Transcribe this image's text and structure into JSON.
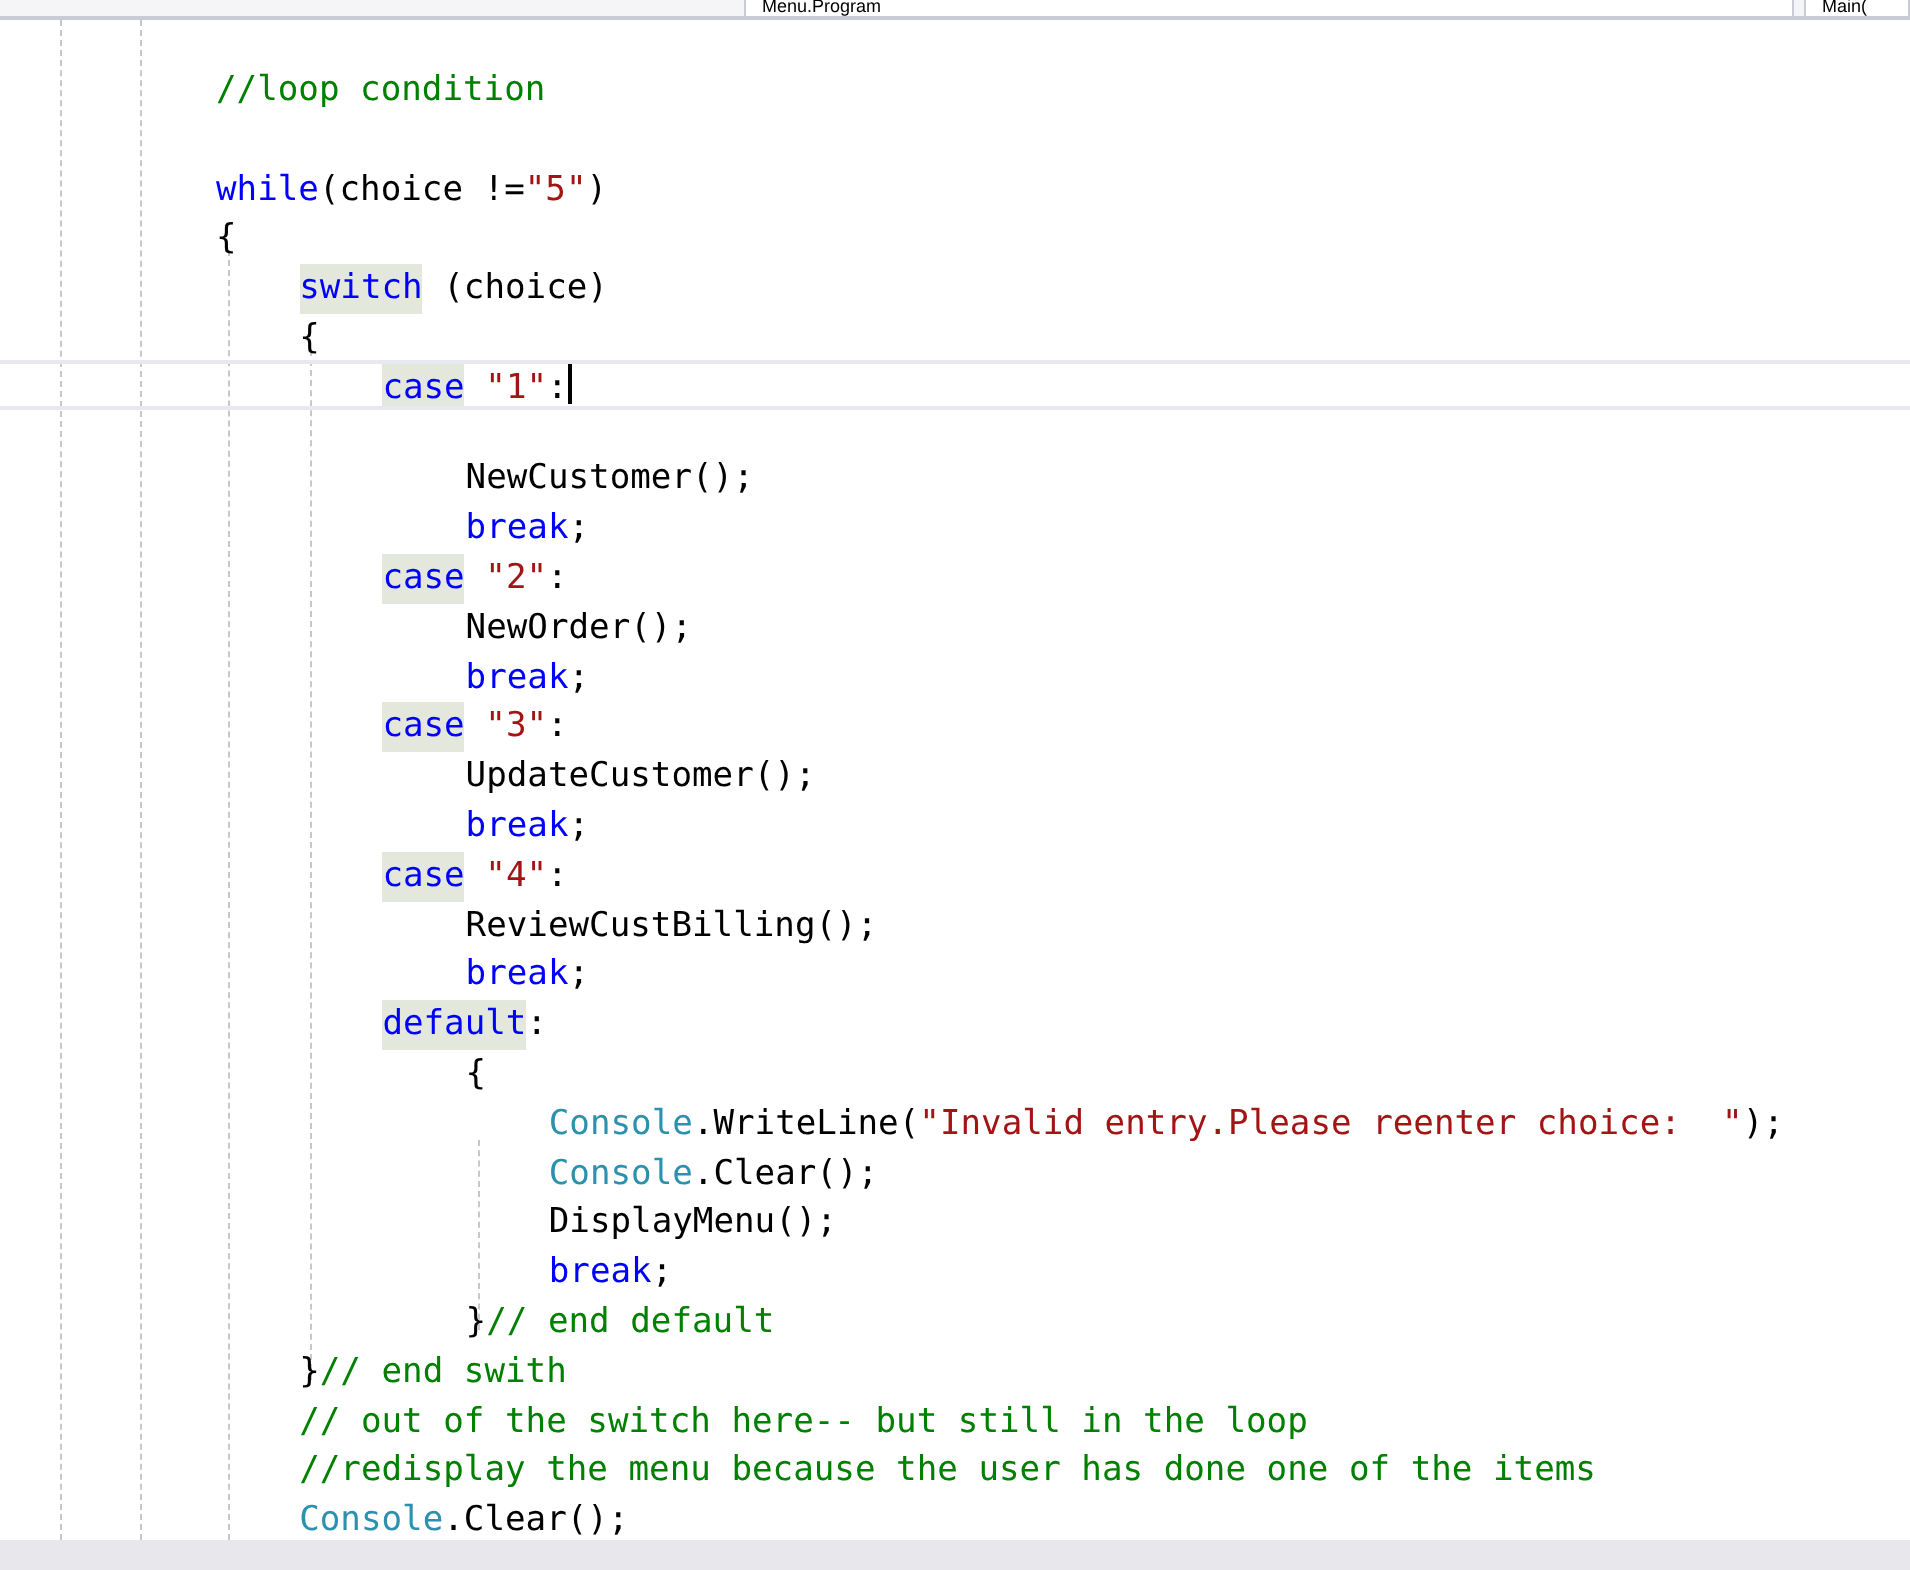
{
  "navigation_bar": {
    "dropdowns": [
      {
        "label": "Menu.Program"
      },
      {
        "label": "Main("
      }
    ]
  },
  "editor": {
    "lines": [
      {
        "kind": "code",
        "tokens": [
          {
            "kind": "comment",
            "text": "//loop condition"
          }
        ]
      },
      {
        "kind": "blank"
      },
      {
        "kind": "code",
        "tokens": [
          {
            "kind": "keyword",
            "text": "while"
          },
          {
            "kind": "plain",
            "text": "(choice !="
          },
          {
            "kind": "string",
            "text": "\"5\""
          },
          {
            "kind": "plain",
            "text": ")"
          }
        ]
      },
      {
        "kind": "code",
        "tokens": [
          {
            "kind": "plain",
            "text": "{"
          }
        ],
        "children": [
          {
            "kind": "code",
            "tokens": [
              {
                "kind": "keyword",
                "text": "switch",
                "highlighted": true
              },
              {
                "kind": "plain",
                "text": " (choice)"
              }
            ]
          },
          {
            "kind": "code",
            "tokens": [
              {
                "kind": "plain",
                "text": "{"
              }
            ],
            "children": [
              {
                "kind": "code",
                "current": true,
                "tokens": [
                  {
                    "kind": "keyword",
                    "text": "case",
                    "highlighted": true
                  },
                  {
                    "kind": "string",
                    "text": " \"1\""
                  },
                  {
                    "kind": "plain",
                    "text": ":"
                  }
                ],
                "children": [
                  {
                    "kind": "blank"
                  },
                  {
                    "kind": "code",
                    "tokens": [
                      {
                        "kind": "plain",
                        "text": "NewCustomer();"
                      }
                    ]
                  },
                  {
                    "kind": "code",
                    "tokens": [
                      {
                        "kind": "keyword",
                        "text": "break"
                      },
                      {
                        "kind": "plain",
                        "text": ";"
                      }
                    ]
                  }
                ]
              },
              {
                "kind": "code",
                "tokens": [
                  {
                    "kind": "keyword",
                    "text": "case",
                    "highlighted": true
                  },
                  {
                    "kind": "string",
                    "text": " \"2\""
                  },
                  {
                    "kind": "plain",
                    "text": ":"
                  }
                ],
                "children": [
                  {
                    "kind": "code",
                    "tokens": [
                      {
                        "kind": "plain",
                        "text": "NewOrder();"
                      }
                    ]
                  },
                  {
                    "kind": "code",
                    "tokens": [
                      {
                        "kind": "keyword",
                        "text": "break"
                      },
                      {
                        "kind": "plain",
                        "text": ";"
                      }
                    ]
                  }
                ]
              },
              {
                "kind": "code",
                "tokens": [
                  {
                    "kind": "keyword",
                    "text": "case",
                    "highlighted": true
                  },
                  {
                    "kind": "string",
                    "text": " \"3\""
                  },
                  {
                    "kind": "plain",
                    "text": ":"
                  }
                ],
                "children": [
                  {
                    "kind": "code",
                    "tokens": [
                      {
                        "kind": "plain",
                        "text": "UpdateCustomer();"
                      }
                    ]
                  },
                  {
                    "kind": "code",
                    "tokens": [
                      {
                        "kind": "keyword",
                        "text": "break"
                      },
                      {
                        "kind": "plain",
                        "text": ";"
                      }
                    ]
                  }
                ]
              },
              {
                "kind": "code",
                "tokens": [
                  {
                    "kind": "keyword",
                    "text": "case",
                    "highlighted": true
                  },
                  {
                    "kind": "string",
                    "text": " \"4\""
                  },
                  {
                    "kind": "plain",
                    "text": ":"
                  }
                ],
                "children": [
                  {
                    "kind": "code",
                    "tokens": [
                      {
                        "kind": "plain",
                        "text": "ReviewCustBilling();"
                      }
                    ]
                  },
                  {
                    "kind": "code",
                    "tokens": [
                      {
                        "kind": "keyword",
                        "text": "break"
                      },
                      {
                        "kind": "plain",
                        "text": ";"
                      }
                    ]
                  }
                ]
              },
              {
                "kind": "code",
                "tokens": [
                  {
                    "kind": "keyword",
                    "text": "default",
                    "highlighted": true
                  },
                  {
                    "kind": "plain",
                    "text": ":"
                  }
                ],
                "children": [
                  {
                    "kind": "code",
                    "tokens": [
                      {
                        "kind": "plain",
                        "text": "{"
                      }
                    ],
                    "children": [
                      {
                        "kind": "code",
                        "tokens": [
                          {
                            "kind": "type",
                            "text": "Console"
                          },
                          {
                            "kind": "plain",
                            "text": ".WriteLine("
                          },
                          {
                            "kind": "string",
                            "text": "\"Invalid entry.Please reenter choice:  \""
                          },
                          {
                            "kind": "plain",
                            "text": ");"
                          }
                        ]
                      },
                      {
                        "kind": "code",
                        "tokens": [
                          {
                            "kind": "type",
                            "text": "Console"
                          },
                          {
                            "kind": "plain",
                            "text": ".Clear();"
                          }
                        ]
                      },
                      {
                        "kind": "code",
                        "tokens": [
                          {
                            "kind": "plain",
                            "text": "DisplayMenu();"
                          }
                        ]
                      },
                      {
                        "kind": "code",
                        "tokens": [
                          {
                            "kind": "keyword",
                            "text": "break"
                          },
                          {
                            "kind": "plain",
                            "text": ";"
                          }
                        ]
                      }
                    ]
                  },
                  {
                    "kind": "code",
                    "tokens": [
                      {
                        "kind": "plain",
                        "text": "}"
                      },
                      {
                        "kind": "comment",
                        "text": "// end default"
                      }
                    ]
                  }
                ]
              }
            ]
          },
          {
            "kind": "code",
            "tokens": [
              {
                "kind": "plain",
                "text": "}"
              },
              {
                "kind": "comment",
                "text": "// end swith"
              }
            ]
          },
          {
            "kind": "code",
            "tokens": [
              {
                "kind": "comment",
                "text": "// out of the switch here-- but still in the loop"
              }
            ]
          },
          {
            "kind": "code",
            "tokens": [
              {
                "kind": "comment",
                "text": "//redisplay the menu because the user has done one of the items"
              }
            ]
          },
          {
            "kind": "code",
            "tokens": [
              {
                "kind": "type",
                "text": "Console"
              },
              {
                "kind": "plain",
                "text": ".Clear();"
              }
            ]
          }
        ]
      }
    ]
  }
}
